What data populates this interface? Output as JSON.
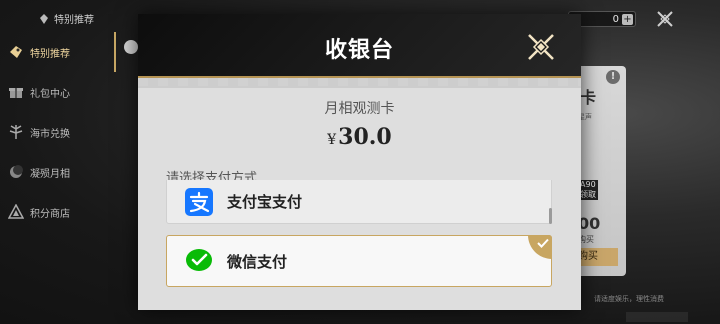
{
  "background": {
    "header_title": "特别推荐",
    "sidebar": [
      {
        "label": "特别推荐",
        "icon": "gift-tag-icon",
        "active": true
      },
      {
        "label": "礼包中心",
        "icon": "gift-box-icon",
        "active": false
      },
      {
        "label": "海市兑换",
        "icon": "tree-icon",
        "active": false
      },
      {
        "label": "凝殒月相",
        "icon": "moon-icon",
        "active": false
      },
      {
        "label": "积分商店",
        "icon": "triangle-shop-icon",
        "active": false
      }
    ],
    "currency_value": "0",
    "currency_add": "+",
    "card": {
      "title": "卡",
      "subtitle": "星声",
      "info": "!",
      "box_text": "A90",
      "box_sub": "领取",
      "big_number": "00",
      "small_text": "购买",
      "buy_label": "购买"
    },
    "disclaimer": "请适度娱乐，理性消费"
  },
  "modal": {
    "title": "收银台",
    "product_name": "月相观测卡",
    "currency_symbol": "¥",
    "price": "30.0",
    "pay_method_label": "请选择支付方式",
    "options": [
      {
        "label": "支付宝支付",
        "icon": "alipay-icon",
        "selected": false
      },
      {
        "label": "微信支付",
        "icon": "wechat-icon",
        "selected": true
      }
    ]
  },
  "colors": {
    "accent_gold": "#c8a661",
    "alipay_blue": "#1677ff",
    "wechat_green": "#09bb07",
    "header_dark": "#151515"
  }
}
